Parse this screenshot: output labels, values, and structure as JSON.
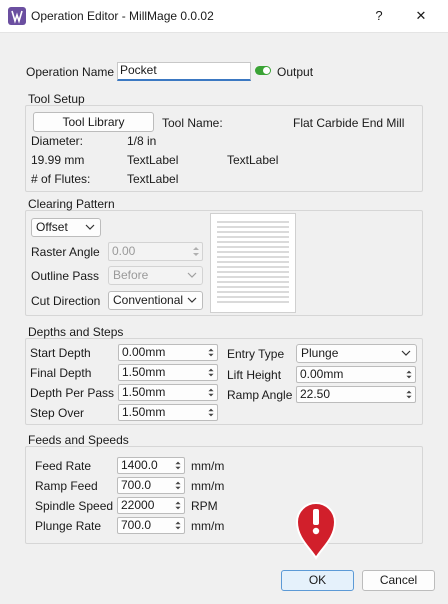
{
  "window": {
    "title": "Operation Editor - MillMage 0.0.02",
    "help_label": "?",
    "close_label": "✕",
    "app_icon": "millmage-logo-icon"
  },
  "operation": {
    "name_label": "Operation Name",
    "name_value": "Pocket",
    "output_label": "Output",
    "output_on": true
  },
  "tool_setup": {
    "title": "Tool Setup",
    "library_button": "Tool Library",
    "tool_name_label": "Tool Name:",
    "tool_name_value": "Flat Carbide End Mill",
    "diameter_label": "Diameter:",
    "diameter_value": "1/8 in",
    "diameter_mm": "19.99 mm",
    "textlabel_1": "TextLabel",
    "textlabel_2": "TextLabel",
    "flutes_label": "# of Flutes:",
    "flutes_value": "TextLabel"
  },
  "clearing": {
    "title": "Clearing Pattern",
    "pattern_value": "Offset",
    "raster_angle_label": "Raster Angle",
    "raster_angle_value": "0.00",
    "outline_pass_label": "Outline Pass",
    "outline_pass_value": "Before",
    "cut_direction_label": "Cut Direction",
    "cut_direction_value": "Conventional"
  },
  "depths": {
    "title": "Depths and Steps",
    "start_depth_label": "Start Depth",
    "start_depth_value": "0.00mm",
    "final_depth_label": "Final Depth",
    "final_depth_value": "1.50mm",
    "depth_per_pass_label": "Depth Per Pass",
    "depth_per_pass_value": "1.50mm",
    "step_over_label": "Step Over",
    "step_over_value": "1.50mm",
    "entry_type_label": "Entry Type",
    "entry_type_value": "Plunge",
    "lift_height_label": "Lift Height",
    "lift_height_value": "0.00mm",
    "ramp_angle_label": "Ramp Angle",
    "ramp_angle_value": "22.50"
  },
  "feeds": {
    "title": "Feeds and Speeds",
    "feed_rate_label": "Feed Rate",
    "feed_rate_value": "1400.0",
    "feed_rate_unit": "mm/m",
    "ramp_feed_label": "Ramp Feed",
    "ramp_feed_value": "700.0",
    "ramp_feed_unit": "mm/m",
    "spindle_speed_label": "Spindle Speed",
    "spindle_speed_value": "22000",
    "spindle_speed_unit": "RPM",
    "plunge_rate_label": "Plunge Rate",
    "plunge_rate_value": "700.0",
    "plunge_rate_unit": "mm/m"
  },
  "buttons": {
    "ok": "OK",
    "cancel": "Cancel"
  },
  "colors": {
    "accent": "#3b78c2",
    "toggle_on": "#3aa335",
    "warning": "#d11f2b"
  }
}
